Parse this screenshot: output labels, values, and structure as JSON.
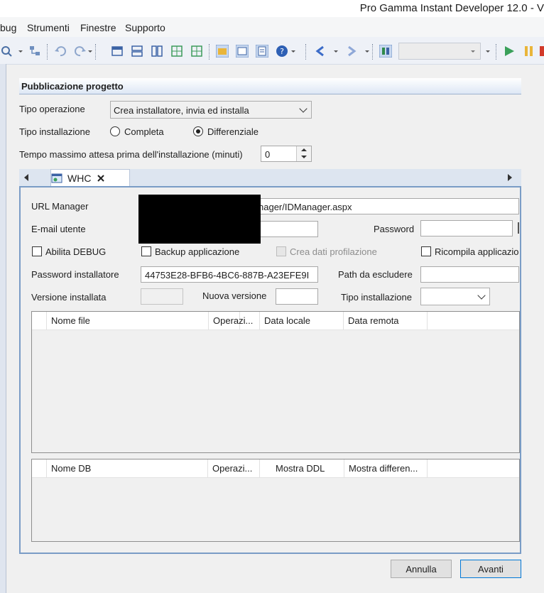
{
  "window": {
    "title": "Pro Gamma Instant Developer 12.0 - V"
  },
  "menu": {
    "items": [
      "bug",
      "Strumenti",
      "Finestre",
      "Supporto"
    ]
  },
  "section": {
    "title": "Pubblicazione progetto"
  },
  "form": {
    "tipo_operazione_label": "Tipo operazione",
    "tipo_operazione_value": "Crea installatore, invia ed installa",
    "tipo_installazione_label": "Tipo installazione",
    "radio_completa": "Completa",
    "radio_differenziale": "Differenziale",
    "tempo_label": "Tempo massimo attesa prima dell'installazione (minuti)",
    "tempo_value": "0"
  },
  "tab": {
    "label": "WHC"
  },
  "whc": {
    "url_label": "URL Manager",
    "url_value": "nager/IDManager.aspx",
    "email_label": "E-mail utente",
    "password_label": "Password",
    "debug_label": "Abilita DEBUG",
    "backup_label": "Backup applicazione",
    "profil_label": "Crea dati profilazione",
    "ricompila_label": "Ricompila applicazio",
    "pwd_inst_label": "Password installatore",
    "pwd_inst_value": "44753E28-BFB6-4BC6-887B-A23EFE9I",
    "path_label": "Path da escludere",
    "ver_inst_label": "Versione installata",
    "nuova_ver_label": "Nuova versione",
    "tipo_inst_label": "Tipo installazione"
  },
  "files_grid": {
    "columns": [
      "Nome file",
      "Operazi...",
      "Data locale",
      "Data remota"
    ]
  },
  "db_grid": {
    "columns": [
      "Nome DB",
      "Operazi...",
      "Mostra DDL",
      "Mostra differen..."
    ]
  },
  "buttons": {
    "cancel": "Annulla",
    "next": "Avanti"
  }
}
